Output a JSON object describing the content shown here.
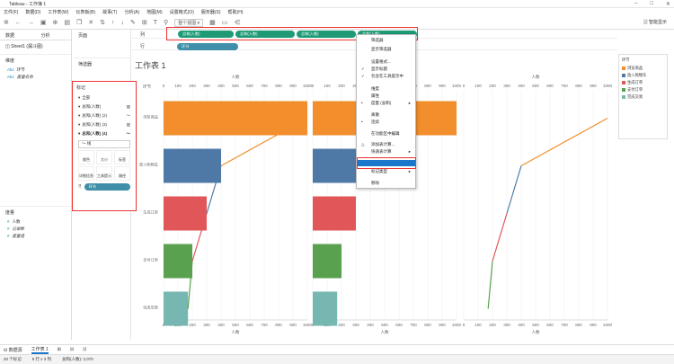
{
  "window": {
    "title": "Tableau - 工作簿 1"
  },
  "menu": [
    "文件(F)",
    "数据(D)",
    "工作表(W)",
    "仪表板(B)",
    "故事(T)",
    "分析(A)",
    "地图(M)",
    "设置格式(O)",
    "服务器(S)",
    "帮助(H)"
  ],
  "toolbar": {
    "fit_label": "整个视图",
    "smart_show": "智能显示"
  },
  "left_pane": {
    "tabs": [
      "数据",
      "分析"
    ],
    "datasource": "Sheet1 (漏斗图)",
    "dimensions_title": "维度",
    "dimensions": [
      "环节",
      "度量名称"
    ],
    "measures_title": "度量",
    "measures": [
      "人数",
      "记录数",
      "度量值"
    ]
  },
  "mid_pane": {
    "pages": "页面",
    "filters": "筛选器"
  },
  "marks": {
    "title": "标记",
    "rows": [
      {
        "label": "全部",
        "bold": false
      },
      {
        "label": "总和(人数)",
        "bold": false
      },
      {
        "label": "总和(人数) (2)",
        "bold": false
      },
      {
        "label": "总和(人数) (3)",
        "bold": false
      },
      {
        "label": "总和(人数) (4)",
        "bold": true
      }
    ],
    "type": "线",
    "buttons": [
      "颜色",
      "大小",
      "标签",
      "详细信息",
      "工具提示",
      "路径"
    ],
    "pill": "环节"
  },
  "shelves": {
    "columns_label": "列",
    "rows_label": "行",
    "column_pills": [
      "总和(人数)",
      "总和(人数)",
      "总和(人数)",
      "总和(人数)"
    ],
    "row_pill": "环节"
  },
  "sheet": {
    "title": "工作表 1",
    "axis_title": "人数",
    "row_header": "环节"
  },
  "context_menu": {
    "items": [
      {
        "label": "筛选器",
        "check": ""
      },
      {
        "label": "显示筛选器",
        "check": ""
      },
      {
        "label": "设置格式...",
        "check": ""
      },
      {
        "label": "显示标题",
        "check": "✓"
      },
      {
        "label": "包含在工具提示中",
        "check": "✓"
      },
      {
        "label": "维度",
        "check": ""
      },
      {
        "label": "属性",
        "check": ""
      },
      {
        "label": "度量 (总和)",
        "check": "•",
        "arrow": "▸"
      },
      {
        "label": "离散",
        "check": ""
      },
      {
        "label": "连续",
        "check": "•"
      },
      {
        "label": "在功能区中编辑",
        "check": ""
      },
      {
        "label": "添加表计算...",
        "check": "△"
      },
      {
        "label": "快速表计算",
        "check": "",
        "arrow": "▸"
      },
      {
        "label": "",
        "check": "",
        "selected": true
      },
      {
        "label": "标记类型",
        "check": "",
        "arrow": "▸"
      },
      {
        "label": "移除",
        "check": ""
      }
    ]
  },
  "legend": {
    "title": "环节",
    "items": [
      {
        "label": "浏览商品",
        "color": "#f28e2b"
      },
      {
        "label": "放入购物车",
        "color": "#4e79a7"
      },
      {
        "label": "生成订单",
        "color": "#e15759"
      },
      {
        "label": "支付订单",
        "color": "#59a14f"
      },
      {
        "label": "完成交易",
        "color": "#76b7b2"
      }
    ]
  },
  "chart_data": {
    "type": "bar",
    "categories": [
      "浏览商品",
      "放入购物车",
      "生成订单",
      "支付订单",
      "完成交易"
    ],
    "values": [
      1000,
      400,
      300,
      200,
      170
    ],
    "colors": [
      "#f28e2b",
      "#4e79a7",
      "#e15759",
      "#59a14f",
      "#76b7b2"
    ],
    "xlabel": "人数",
    "xlim": [
      0,
      1000
    ],
    "ticks": [
      0,
      100,
      200,
      300,
      400,
      500,
      600,
      700,
      800,
      900,
      1000
    ]
  },
  "sheet_tabs": [
    "数据源",
    "工作表 1"
  ],
  "status": {
    "marks": "20 个标记",
    "rows_cols": "5 行 x 3 列",
    "sum": "总和(人数): 2,070"
  }
}
